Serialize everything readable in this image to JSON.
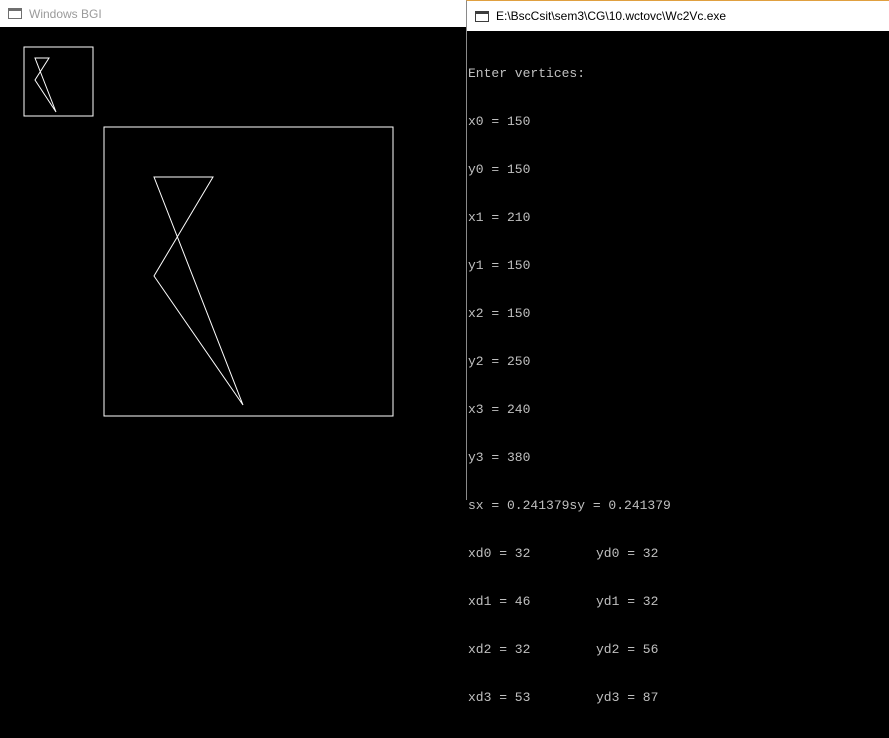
{
  "bgi_window": {
    "title": "Windows BGI"
  },
  "console_window": {
    "title": "E:\\BscCsit\\sem3\\CG\\10.wctovc\\Wc2Vc.exe",
    "lines": [
      "Enter vertices:",
      "x0 = 150",
      "y0 = 150",
      "x1 = 210",
      "y1 = 150",
      "x2 = 150",
      "y2 = 250",
      "x3 = 240",
      "y3 = 380",
      "sx = 0.241379sy = 0.241379"
    ],
    "pairs": [
      [
        "xd0 = 32",
        "yd0 = 32"
      ],
      [
        "xd1 = 46",
        "yd1 = 32"
      ],
      [
        "xd2 = 32",
        "yd2 = 56"
      ],
      [
        "xd3 = 53",
        "yd3 = 87"
      ]
    ]
  },
  "colors": {
    "canvas_bg": "#000000",
    "stroke": "#ffffff",
    "console_text": "#c0c0c0"
  }
}
